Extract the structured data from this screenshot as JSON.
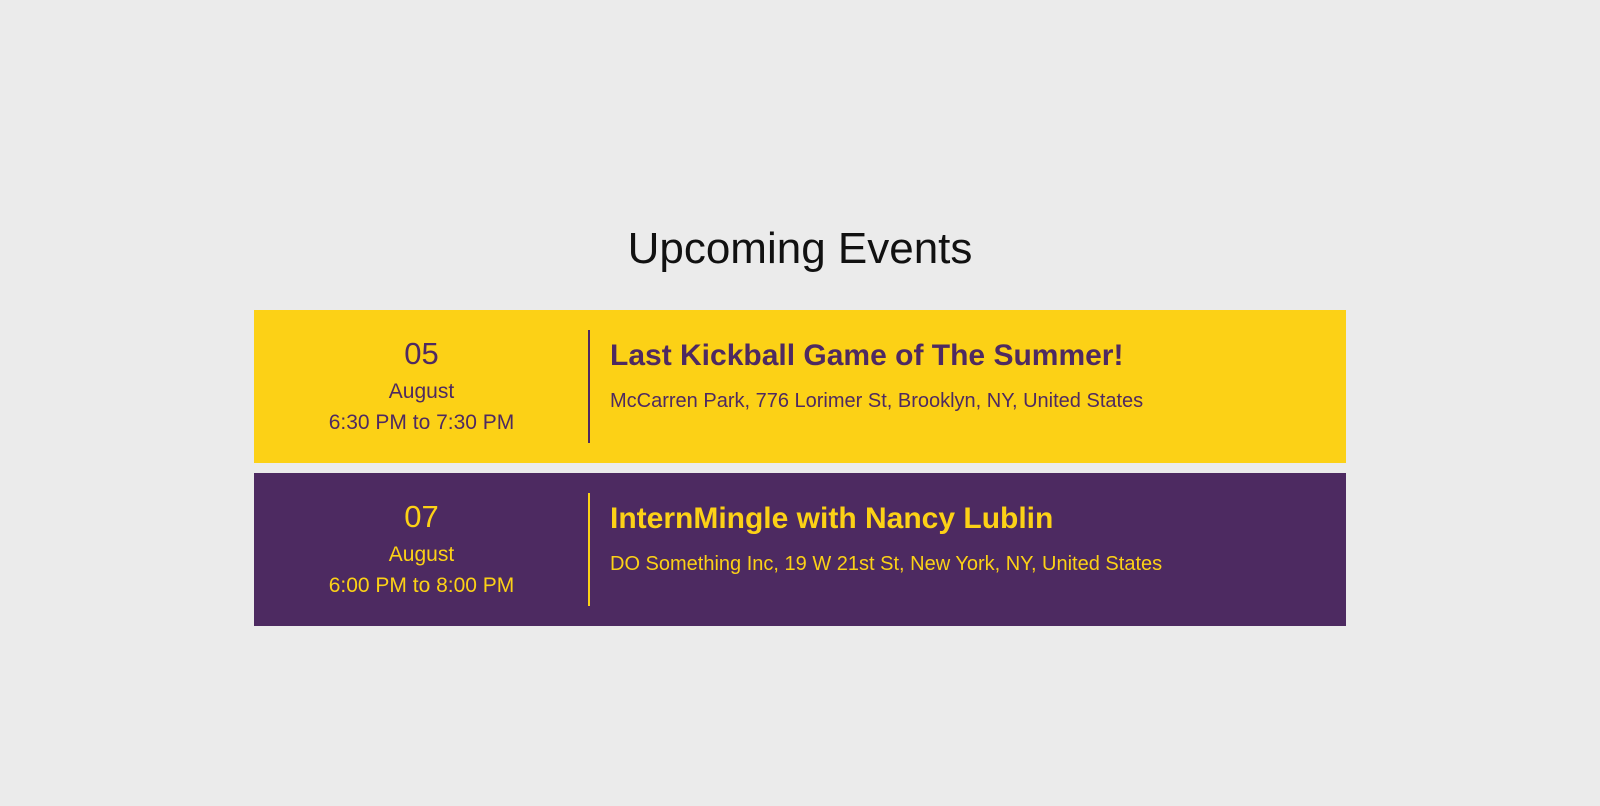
{
  "section": {
    "title": "Upcoming Events"
  },
  "events": [
    {
      "day": "05",
      "month": "August",
      "time": "6:30 PM to 7:30 PM",
      "title": "Last Kickball Game of The Summer!",
      "location": "McCarren Park, 776 Lorimer St, Brooklyn, NY, United States",
      "style": "yellow"
    },
    {
      "day": "07",
      "month": "August",
      "time": "6:00 PM to 8:00 PM",
      "title": "InternMingle with Nancy Lublin",
      "location": "DO Something Inc, 19 W 21st St, New York, NY, United States",
      "style": "purple"
    }
  ],
  "colors": {
    "page_background": "#ebebeb",
    "yellow": "#fcd116",
    "purple": "#4d2a61"
  }
}
